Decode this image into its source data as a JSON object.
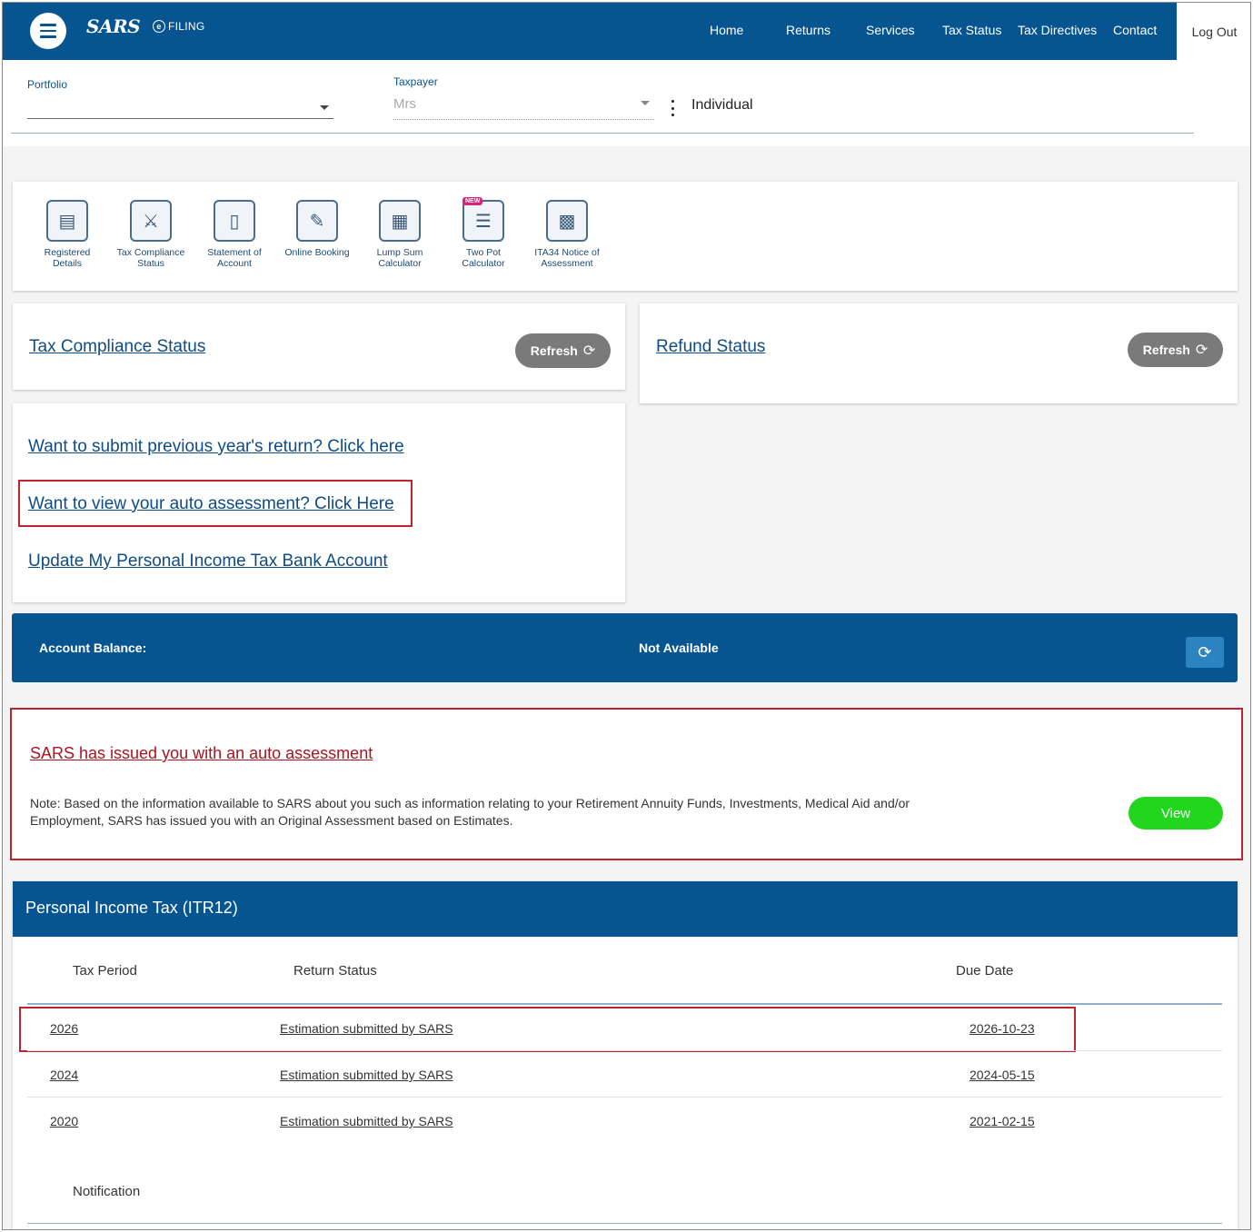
{
  "header": {
    "logo_text": "SARS",
    "logo_sub": "FILING",
    "nav": [
      "Home",
      "Returns",
      "Services",
      "Tax Status",
      "Tax Directives",
      "Contact"
    ],
    "logout": "Log Out"
  },
  "filter": {
    "portfolio_label": "Portfolio",
    "taxpayer_label": "Taxpayer",
    "taxpayer_value": "Mrs",
    "taxpayer_type": "Individual"
  },
  "quick_links": [
    {
      "label": "Registered Details",
      "icon": "id-card-icon"
    },
    {
      "label": "Tax Compliance Status",
      "icon": "compliance-bag-icon"
    },
    {
      "label": "Statement of Account",
      "icon": "statement-icon"
    },
    {
      "label": "Online Booking",
      "icon": "booking-icon"
    },
    {
      "label": "Lump Sum Calculator",
      "icon": "calculator-icon"
    },
    {
      "label": "Two Pot Calculator",
      "icon": "two-pot-icon",
      "badge": "NEW"
    },
    {
      "label": "ITA34 Notice of Assessment",
      "icon": "notice-icon"
    }
  ],
  "compliance": {
    "title": "Tax Compliance Status",
    "refresh": "Refresh"
  },
  "refund": {
    "title": "Refund Status",
    "refresh": "Refresh"
  },
  "links": {
    "previous_return": "Want to submit previous year's return? Click here",
    "auto_assessment": "Want to view your auto assessment? Click Here",
    "bank_account": "Update My Personal Income Tax Bank Account"
  },
  "balance": {
    "label": "Account Balance:",
    "value": "Not Available"
  },
  "auto_assessment": {
    "title": "SARS has issued you with an auto assessment",
    "note": "Note: Based on the information available to SARS about you such as information relating to your Retirement Annuity Funds, Investments, Medical Aid and/or Employment, SARS has issued you with an Original Assessment based on Estimates.",
    "view": "View"
  },
  "pit": {
    "title": "Personal Income Tax (ITR12)",
    "columns": [
      "Tax Period",
      "Return Status",
      "Due Date"
    ],
    "rows": [
      {
        "period": "2026",
        "status": "Estimation submitted by SARS",
        "due": "2026-10-23"
      },
      {
        "period": "2024",
        "status": "Estimation submitted by SARS",
        "due": "2024-05-15"
      },
      {
        "period": "2020",
        "status": "Estimation submitted by SARS",
        "due": "2021-02-15"
      }
    ],
    "notification": "Notification"
  },
  "colors": {
    "primary": "#065591",
    "highlight": "#c0232f",
    "view_button": "#22d61e",
    "refresh_button": "#7a7a7a"
  }
}
